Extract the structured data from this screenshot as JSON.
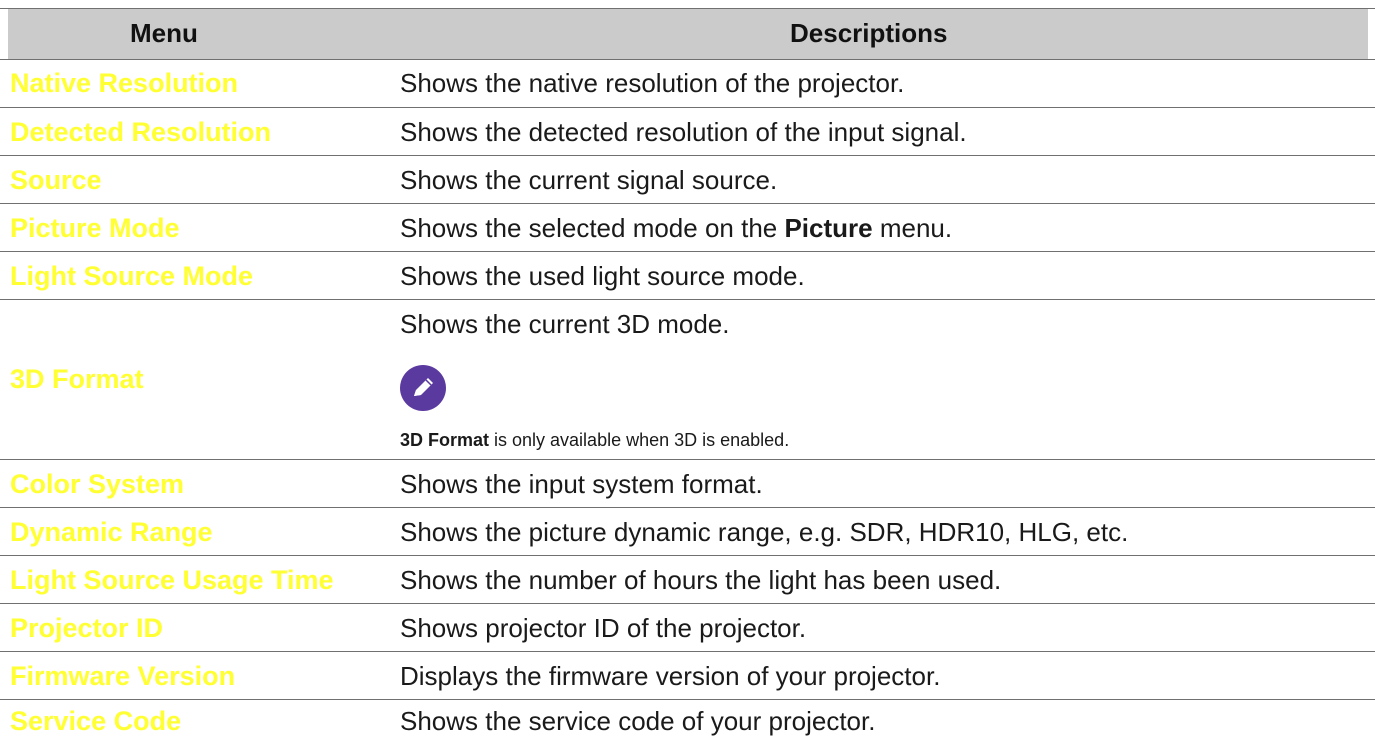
{
  "table": {
    "header": {
      "menu": "Menu",
      "descriptions": "Descriptions"
    },
    "rows": [
      {
        "menu": "Native Resolution",
        "desc": "Shows the native resolution of the projector."
      },
      {
        "menu": "Detected Resolution",
        "desc": "Shows the detected resolution of the input signal."
      },
      {
        "menu": "Source",
        "desc": "Shows the current signal source."
      },
      {
        "menu": "Picture Mode",
        "desc_pre": "Shows the selected mode on the ",
        "desc_bold": "Picture",
        "desc_post": " menu."
      },
      {
        "menu": "Light Source Mode",
        "desc": "Shows the used light source mode."
      },
      {
        "menu": "3D Format",
        "desc": "Shows the current 3D mode.",
        "note_icon": "pencil-note-icon",
        "note_bold": "3D Format",
        "note_rest": " is only available when 3D is enabled."
      },
      {
        "menu": "Color System",
        "desc": "Shows the input system format."
      },
      {
        "menu": "Dynamic Range",
        "desc": "Shows the picture dynamic range, e.g. SDR, HDR10, HLG, etc."
      },
      {
        "menu": "Light Source Usage Time",
        "desc": "Shows the number of hours the light has been used."
      },
      {
        "menu": "Projector ID",
        "desc": "Shows projector ID of the projector."
      },
      {
        "menu": "Firmware Version",
        "desc": "Displays the firmware version of your projector."
      },
      {
        "menu": "Service Code",
        "desc": "Shows the service code of your projector."
      }
    ]
  },
  "colors": {
    "menu_text": "#ffff33",
    "header_bg": "#cbcbcb",
    "note_icon_bg": "#5b3aa0"
  }
}
